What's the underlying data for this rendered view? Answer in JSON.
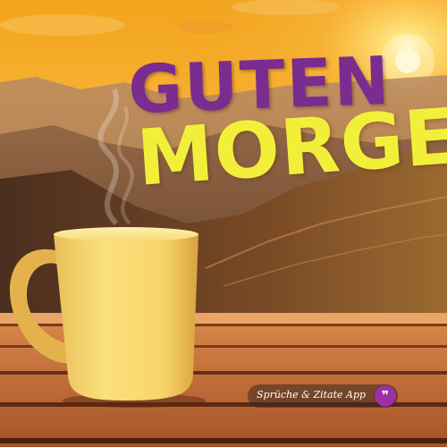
{
  "greeting": {
    "line1": "GUTEN",
    "line2": "MORGEN!"
  },
  "watermark": {
    "label": "Sprüche & Zitate App",
    "icon": "quote-icon",
    "icon_glyph": "❞"
  },
  "colors": {
    "line1": "#7b2c8f",
    "line2": "#f2ef3a",
    "badge_icon": "#9b2fa6"
  }
}
